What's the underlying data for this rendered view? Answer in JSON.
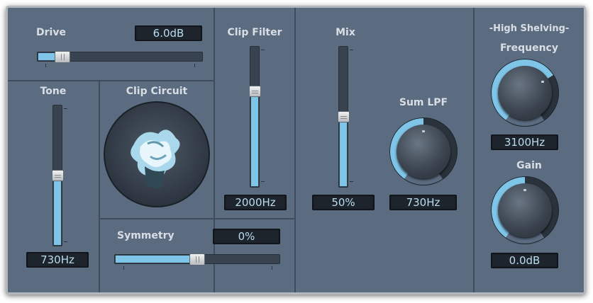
{
  "drive": {
    "label": "Drive",
    "value": "6.0dB",
    "level": 0.15
  },
  "tone": {
    "label": "Tone",
    "value": "730Hz",
    "level": 0.5
  },
  "clip_circuit": {
    "label": "Clip Circuit",
    "graphic": "clip-circuit-animation-icon"
  },
  "clip_filter": {
    "label": "Clip Filter",
    "value": "2000Hz",
    "level": 0.68
  },
  "symmetry": {
    "label": "Symmetry",
    "value": "0%",
    "level": 0.5
  },
  "mix": {
    "label": "Mix",
    "value": "50%",
    "level": 0.5
  },
  "sum_lpf": {
    "label": "Sum LPF",
    "value": "730Hz",
    "level": 0.5
  },
  "high_shelving": {
    "section_label": "-High Shelving-",
    "frequency": {
      "label": "Frequency",
      "value": "3100Hz",
      "level": 0.7
    },
    "gain": {
      "label": "Gain",
      "value": "0.0dB",
      "level": 0.5
    }
  },
  "colors": {
    "panel": "#5b6b80",
    "accent": "#7fc5e8",
    "display_bg": "#1e242c",
    "display_text": "#b9dcef"
  }
}
